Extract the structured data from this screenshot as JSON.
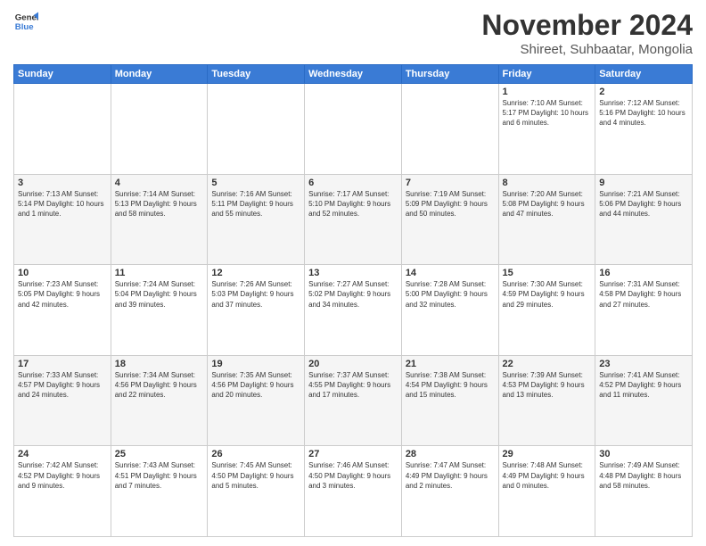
{
  "logo": {
    "line1": "General",
    "line2": "Blue"
  },
  "title": "November 2024",
  "subtitle": "Shireet, Suhbaatar, Mongolia",
  "weekdays": [
    "Sunday",
    "Monday",
    "Tuesday",
    "Wednesday",
    "Thursday",
    "Friday",
    "Saturday"
  ],
  "weeks": [
    [
      {
        "day": "",
        "info": ""
      },
      {
        "day": "",
        "info": ""
      },
      {
        "day": "",
        "info": ""
      },
      {
        "day": "",
        "info": ""
      },
      {
        "day": "",
        "info": ""
      },
      {
        "day": "1",
        "info": "Sunrise: 7:10 AM\nSunset: 5:17 PM\nDaylight: 10 hours and 6 minutes."
      },
      {
        "day": "2",
        "info": "Sunrise: 7:12 AM\nSunset: 5:16 PM\nDaylight: 10 hours and 4 minutes."
      }
    ],
    [
      {
        "day": "3",
        "info": "Sunrise: 7:13 AM\nSunset: 5:14 PM\nDaylight: 10 hours and 1 minute."
      },
      {
        "day": "4",
        "info": "Sunrise: 7:14 AM\nSunset: 5:13 PM\nDaylight: 9 hours and 58 minutes."
      },
      {
        "day": "5",
        "info": "Sunrise: 7:16 AM\nSunset: 5:11 PM\nDaylight: 9 hours and 55 minutes."
      },
      {
        "day": "6",
        "info": "Sunrise: 7:17 AM\nSunset: 5:10 PM\nDaylight: 9 hours and 52 minutes."
      },
      {
        "day": "7",
        "info": "Sunrise: 7:19 AM\nSunset: 5:09 PM\nDaylight: 9 hours and 50 minutes."
      },
      {
        "day": "8",
        "info": "Sunrise: 7:20 AM\nSunset: 5:08 PM\nDaylight: 9 hours and 47 minutes."
      },
      {
        "day": "9",
        "info": "Sunrise: 7:21 AM\nSunset: 5:06 PM\nDaylight: 9 hours and 44 minutes."
      }
    ],
    [
      {
        "day": "10",
        "info": "Sunrise: 7:23 AM\nSunset: 5:05 PM\nDaylight: 9 hours and 42 minutes."
      },
      {
        "day": "11",
        "info": "Sunrise: 7:24 AM\nSunset: 5:04 PM\nDaylight: 9 hours and 39 minutes."
      },
      {
        "day": "12",
        "info": "Sunrise: 7:26 AM\nSunset: 5:03 PM\nDaylight: 9 hours and 37 minutes."
      },
      {
        "day": "13",
        "info": "Sunrise: 7:27 AM\nSunset: 5:02 PM\nDaylight: 9 hours and 34 minutes."
      },
      {
        "day": "14",
        "info": "Sunrise: 7:28 AM\nSunset: 5:00 PM\nDaylight: 9 hours and 32 minutes."
      },
      {
        "day": "15",
        "info": "Sunrise: 7:30 AM\nSunset: 4:59 PM\nDaylight: 9 hours and 29 minutes."
      },
      {
        "day": "16",
        "info": "Sunrise: 7:31 AM\nSunset: 4:58 PM\nDaylight: 9 hours and 27 minutes."
      }
    ],
    [
      {
        "day": "17",
        "info": "Sunrise: 7:33 AM\nSunset: 4:57 PM\nDaylight: 9 hours and 24 minutes."
      },
      {
        "day": "18",
        "info": "Sunrise: 7:34 AM\nSunset: 4:56 PM\nDaylight: 9 hours and 22 minutes."
      },
      {
        "day": "19",
        "info": "Sunrise: 7:35 AM\nSunset: 4:56 PM\nDaylight: 9 hours and 20 minutes."
      },
      {
        "day": "20",
        "info": "Sunrise: 7:37 AM\nSunset: 4:55 PM\nDaylight: 9 hours and 17 minutes."
      },
      {
        "day": "21",
        "info": "Sunrise: 7:38 AM\nSunset: 4:54 PM\nDaylight: 9 hours and 15 minutes."
      },
      {
        "day": "22",
        "info": "Sunrise: 7:39 AM\nSunset: 4:53 PM\nDaylight: 9 hours and 13 minutes."
      },
      {
        "day": "23",
        "info": "Sunrise: 7:41 AM\nSunset: 4:52 PM\nDaylight: 9 hours and 11 minutes."
      }
    ],
    [
      {
        "day": "24",
        "info": "Sunrise: 7:42 AM\nSunset: 4:52 PM\nDaylight: 9 hours and 9 minutes."
      },
      {
        "day": "25",
        "info": "Sunrise: 7:43 AM\nSunset: 4:51 PM\nDaylight: 9 hours and 7 minutes."
      },
      {
        "day": "26",
        "info": "Sunrise: 7:45 AM\nSunset: 4:50 PM\nDaylight: 9 hours and 5 minutes."
      },
      {
        "day": "27",
        "info": "Sunrise: 7:46 AM\nSunset: 4:50 PM\nDaylight: 9 hours and 3 minutes."
      },
      {
        "day": "28",
        "info": "Sunrise: 7:47 AM\nSunset: 4:49 PM\nDaylight: 9 hours and 2 minutes."
      },
      {
        "day": "29",
        "info": "Sunrise: 7:48 AM\nSunset: 4:49 PM\nDaylight: 9 hours and 0 minutes."
      },
      {
        "day": "30",
        "info": "Sunrise: 7:49 AM\nSunset: 4:48 PM\nDaylight: 8 hours and 58 minutes."
      }
    ]
  ]
}
